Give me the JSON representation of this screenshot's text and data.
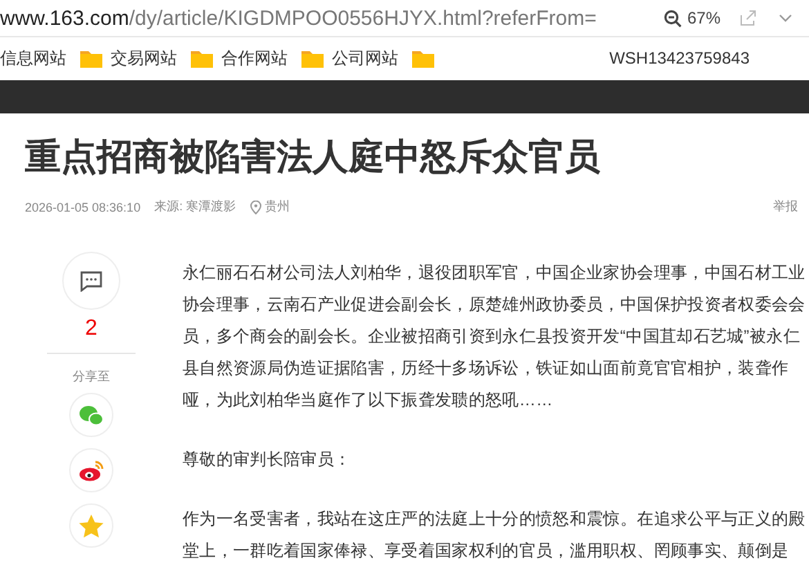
{
  "address_bar": {
    "host": "www.163.com",
    "path": "/dy/article/KIGDMPOO0556HJYX.html?referFrom=",
    "zoom": "67%"
  },
  "bookmarks": [
    {
      "kind": "text",
      "label": "信息网站"
    },
    {
      "kind": "folder",
      "label": "交易网站"
    },
    {
      "kind": "folder",
      "label": "合作网站"
    },
    {
      "kind": "folder",
      "label": "公司网站"
    },
    {
      "kind": "folder"
    }
  ],
  "user": "WSH13423759843",
  "article": {
    "title": "重点招商被陷害法人庭中怒斥众官员",
    "date": "2026-01-05 08:36:10",
    "source": "来源: 寒潭渡影",
    "location": "贵州",
    "report": "举报",
    "paragraphs": [
      "永仁丽石石材公司法人刘柏华，退役团职军官，中国企业家协会理事，中国石材工业协会理事，云南石产业促进会副会长，原楚雄州政协委员，中国保护投资者权委会会员，多个商会的副会长。企业被招商引资到永仁县投资开发“中国苴却石艺城”被永仁县自然资源局伪造证据陷害，历经十多场诉讼，铁证如山面前竟官官相护，装聋作哑，为此刘柏华当庭作了以下振聋发聩的怒吼……",
      "尊敬的审判长陪审员：",
      "作为一名受害者，我站在这庄严的法庭上十分的愤怒和震惊。在追求公平与正义的殿堂上，一群吃着国家俸禄、享受着国家权利的官员，滥用职权、罔顾事实、颠倒是"
    ]
  },
  "side": {
    "comment_count": "2",
    "share_label": "分享至",
    "share_targets": [
      {
        "kind": "wechat"
      },
      {
        "kind": "weibo"
      },
      {
        "kind": "qzone"
      }
    ]
  }
}
